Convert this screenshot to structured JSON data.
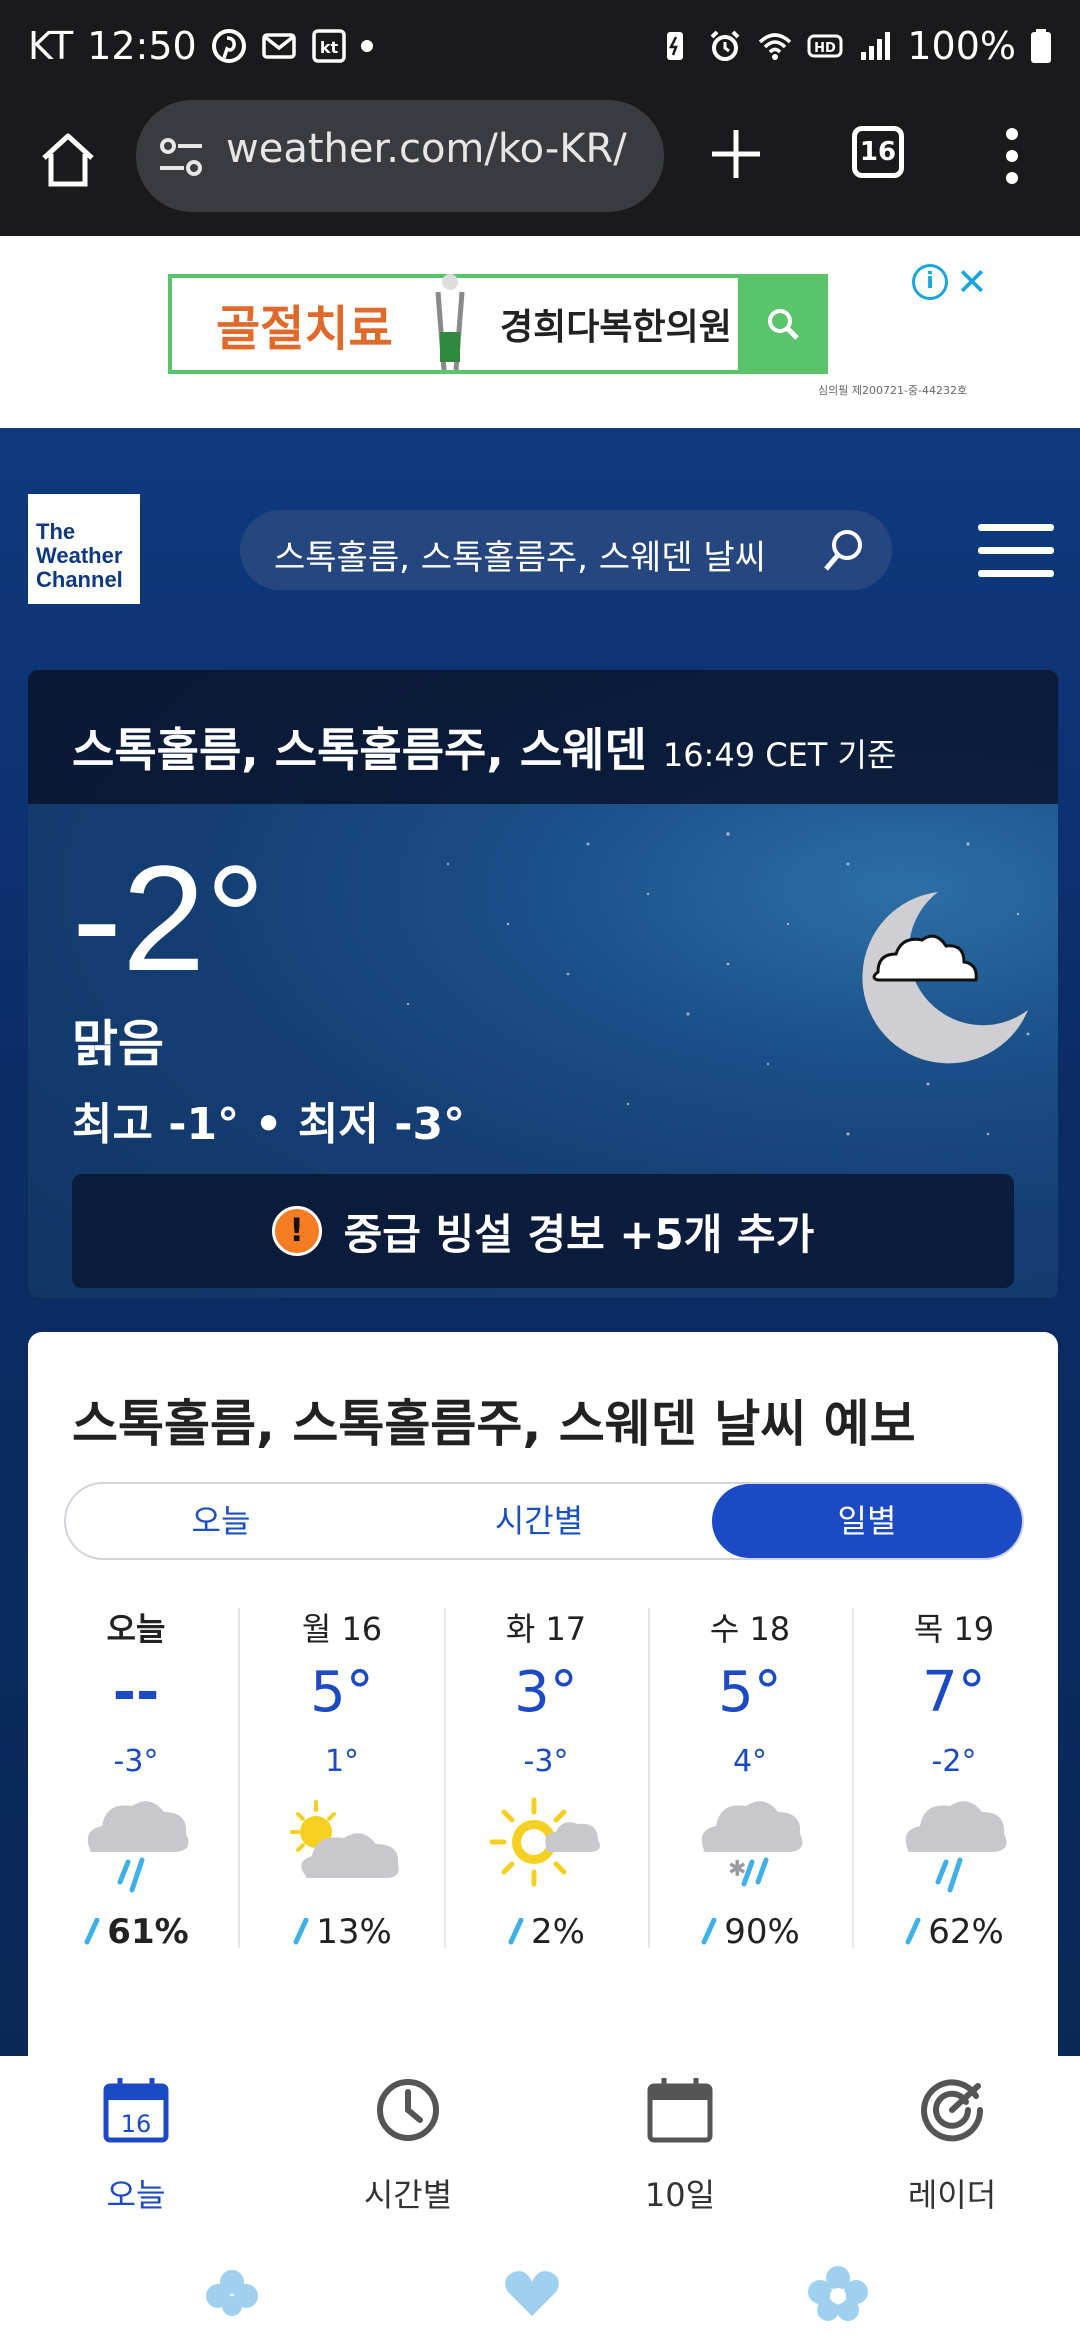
{
  "status_bar": {
    "carrier": "KT",
    "time": "12:50",
    "battery": "100%"
  },
  "browser": {
    "url": "weather.com/ko-KR/",
    "tab_count": "16"
  },
  "ad": {
    "left_text": "골절치료",
    "mid_text": "경희다복한의원",
    "small_print": "심의필 제200721-중-44232호",
    "info_label": "i",
    "close_label": "✕"
  },
  "site": {
    "logo_lines": [
      "The",
      "Weather",
      "Channel"
    ],
    "search_text": "스톡홀름, 스톡홀름주, 스웨덴 날씨"
  },
  "current": {
    "location": "스톡홀름, 스톡홀름주, 스웨덴",
    "time": "16:49 CET 기준",
    "temperature": "-2°",
    "condition": "맑음",
    "hilo": "최고 -1° • 최저 -3°",
    "alert_icon": "!",
    "alert_text": "중급 빙설 경보 +5개 추가"
  },
  "forecast": {
    "title": "스톡홀름, 스톡홀름주, 스웨덴 날씨 예보",
    "tabs": [
      "오늘",
      "시간별",
      "일별"
    ],
    "active_tab": "일별",
    "days": [
      {
        "label": "오늘",
        "high": "--",
        "low": "-3°",
        "icon": "rain-icon",
        "precip": "61%"
      },
      {
        "label": "월 16",
        "high": "5°",
        "low": "1°",
        "icon": "partly-cloudy-icon",
        "precip": "13%"
      },
      {
        "label": "화 17",
        "high": "3°",
        "low": "-3°",
        "icon": "sun-cloud-icon",
        "precip": "2%"
      },
      {
        "label": "수 18",
        "high": "5°",
        "low": "4°",
        "icon": "rain-snow-icon",
        "precip": "90%"
      },
      {
        "label": "목 19",
        "high": "7°",
        "low": "-2°",
        "icon": "rain-icon",
        "precip": "62%"
      }
    ]
  },
  "bottom_nav": {
    "items": [
      {
        "label": "오늘",
        "icon": "calendar-today-icon",
        "badge": "16"
      },
      {
        "label": "시간별",
        "icon": "clock-icon"
      },
      {
        "label": "10일",
        "icon": "calendar-icon"
      },
      {
        "label": "레이더",
        "icon": "radar-icon"
      }
    ],
    "active": "오늘"
  },
  "colors": {
    "accent": "#1c49c4",
    "alert": "#f57c22",
    "precip": "#3fb0e8"
  }
}
